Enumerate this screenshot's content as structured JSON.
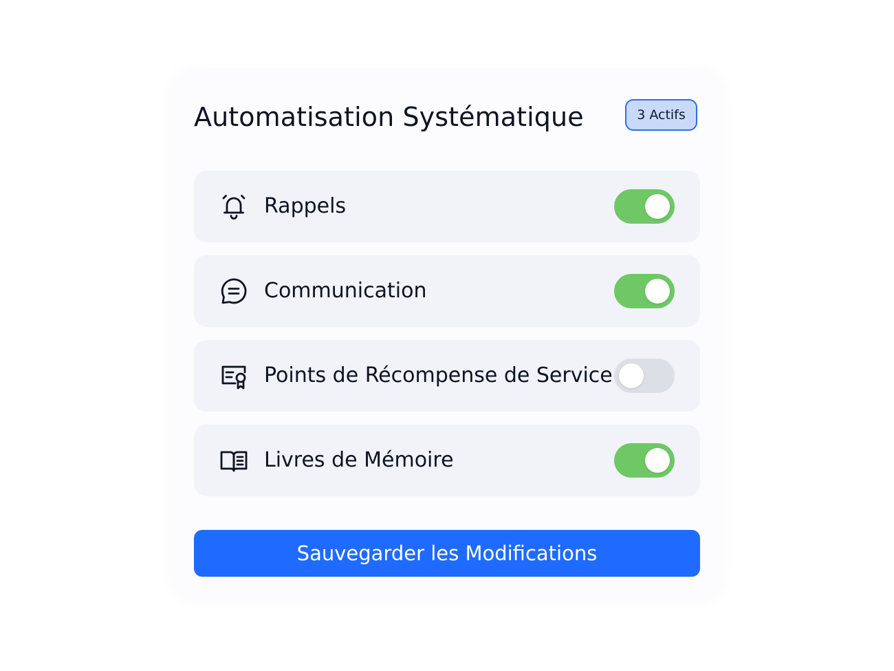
{
  "panel": {
    "title": "Automatisation Systématique",
    "badge": "3 Actifs"
  },
  "settings": [
    {
      "label": "Rappels",
      "icon": "alarm-bell-icon",
      "enabled": true
    },
    {
      "label": "Communication",
      "icon": "message-bubble-icon",
      "enabled": true
    },
    {
      "label": "Points de Récompense de Service",
      "icon": "certificate-icon",
      "enabled": false
    },
    {
      "label": "Livres de Mémoire",
      "icon": "open-book-icon",
      "enabled": true
    }
  ],
  "save_button": {
    "label": "Sauvegarder les Modifications"
  },
  "colors": {
    "toggle_on": "#6fc766",
    "toggle_off": "#dcdfe5",
    "primary": "#1f6bff",
    "badge_border": "#2d6cf0",
    "badge_fill": "#c9daf8"
  }
}
